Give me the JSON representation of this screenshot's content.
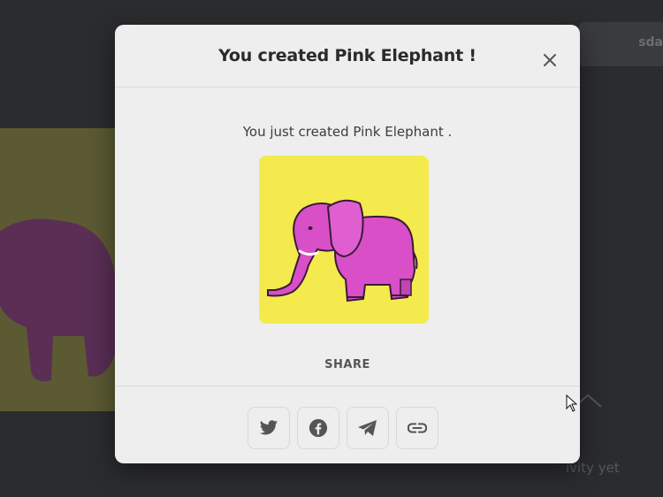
{
  "modal": {
    "title": "You created Pink Elephant !",
    "message": "You just created Pink Elephant .",
    "share_label": "SHARE",
    "share_buttons": [
      {
        "name": "twitter",
        "icon": "twitter-icon"
      },
      {
        "name": "facebook",
        "icon": "facebook-icon"
      },
      {
        "name": "telegram",
        "icon": "telegram-icon"
      },
      {
        "name": "copy-link",
        "icon": "link-icon"
      }
    ],
    "close_icon": "close-icon"
  },
  "nft": {
    "name": "Pink Elephant",
    "background_color": "#f4ea4e",
    "elephant_color": "#d94fc8"
  },
  "background": {
    "top_right_text": "sda",
    "bottom_right_text": "ivity yet"
  },
  "colors": {
    "overlay": "#2b2c2e",
    "modal_bg": "#eeeeee",
    "text": "#2a2a2a"
  }
}
